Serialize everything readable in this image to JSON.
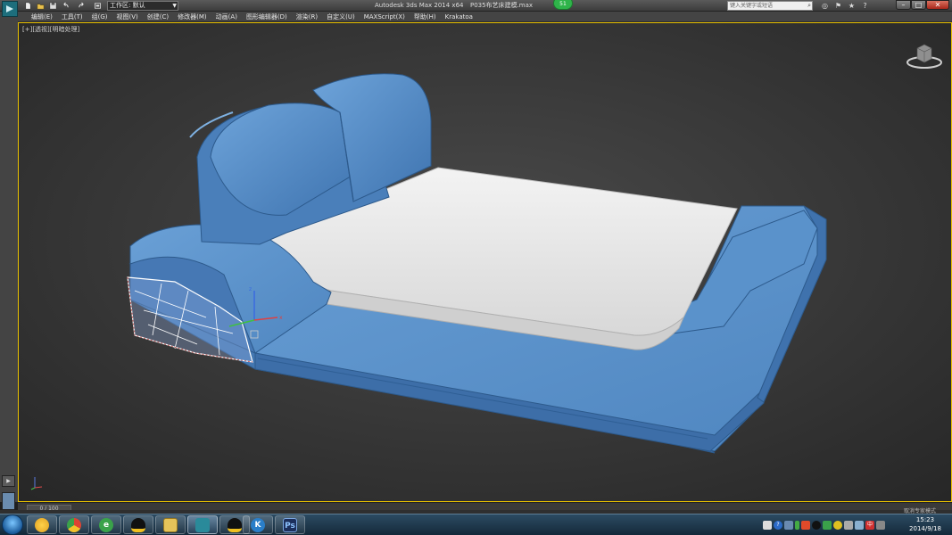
{
  "titlebar": {
    "workspace_label": "工作区: 默认",
    "app_title": "Autodesk 3ds Max  2014 x64",
    "file_title": "P035布艺床建模.max",
    "badge": "51",
    "search_placeholder": "键入关键字或短语"
  },
  "menu": {
    "items": [
      "编辑(E)",
      "工具(T)",
      "组(G)",
      "视图(V)",
      "创建(C)",
      "修改器(M)",
      "动画(A)",
      "图形编辑器(D)",
      "渲染(R)",
      "自定义(U)",
      "MAXScript(X)",
      "帮助(H)",
      "Krakatoa"
    ]
  },
  "viewport": {
    "label_parts": [
      "[+]",
      "[透视]",
      "[明暗处理]"
    ],
    "colors": {
      "bed_frame": "#4f87c4",
      "mattress": "#e6e6e6",
      "background": "#3e3e3e",
      "selection": "#ffffff",
      "active_border": "#e8c000"
    }
  },
  "timeline": {
    "frame_display": "0 / 100"
  },
  "status": {
    "notify": "取消专家模式"
  },
  "taskbar": {
    "apps": [
      {
        "name": "media-player",
        "glyph": "",
        "color": "#e0a020"
      },
      {
        "name": "chrome",
        "glyph": "",
        "color": "#dd4433"
      },
      {
        "name": "360-browser",
        "glyph": "e",
        "color": "#3aa24a"
      },
      {
        "name": "qq",
        "glyph": "",
        "color": "#111111"
      },
      {
        "name": "explorer",
        "glyph": "",
        "color": "#e5c45a"
      },
      {
        "name": "3dsmax",
        "glyph": "",
        "color": "#2a8a9a"
      },
      {
        "name": "qq-2",
        "glyph": "",
        "color": "#111111"
      },
      {
        "name": "kugou",
        "glyph": "K",
        "color": "#2a7ec8"
      },
      {
        "name": "photoshop",
        "glyph": "Ps",
        "color": "#1c2f5c"
      }
    ],
    "clock_time": "15:23",
    "clock_date": "2014/9/18"
  }
}
